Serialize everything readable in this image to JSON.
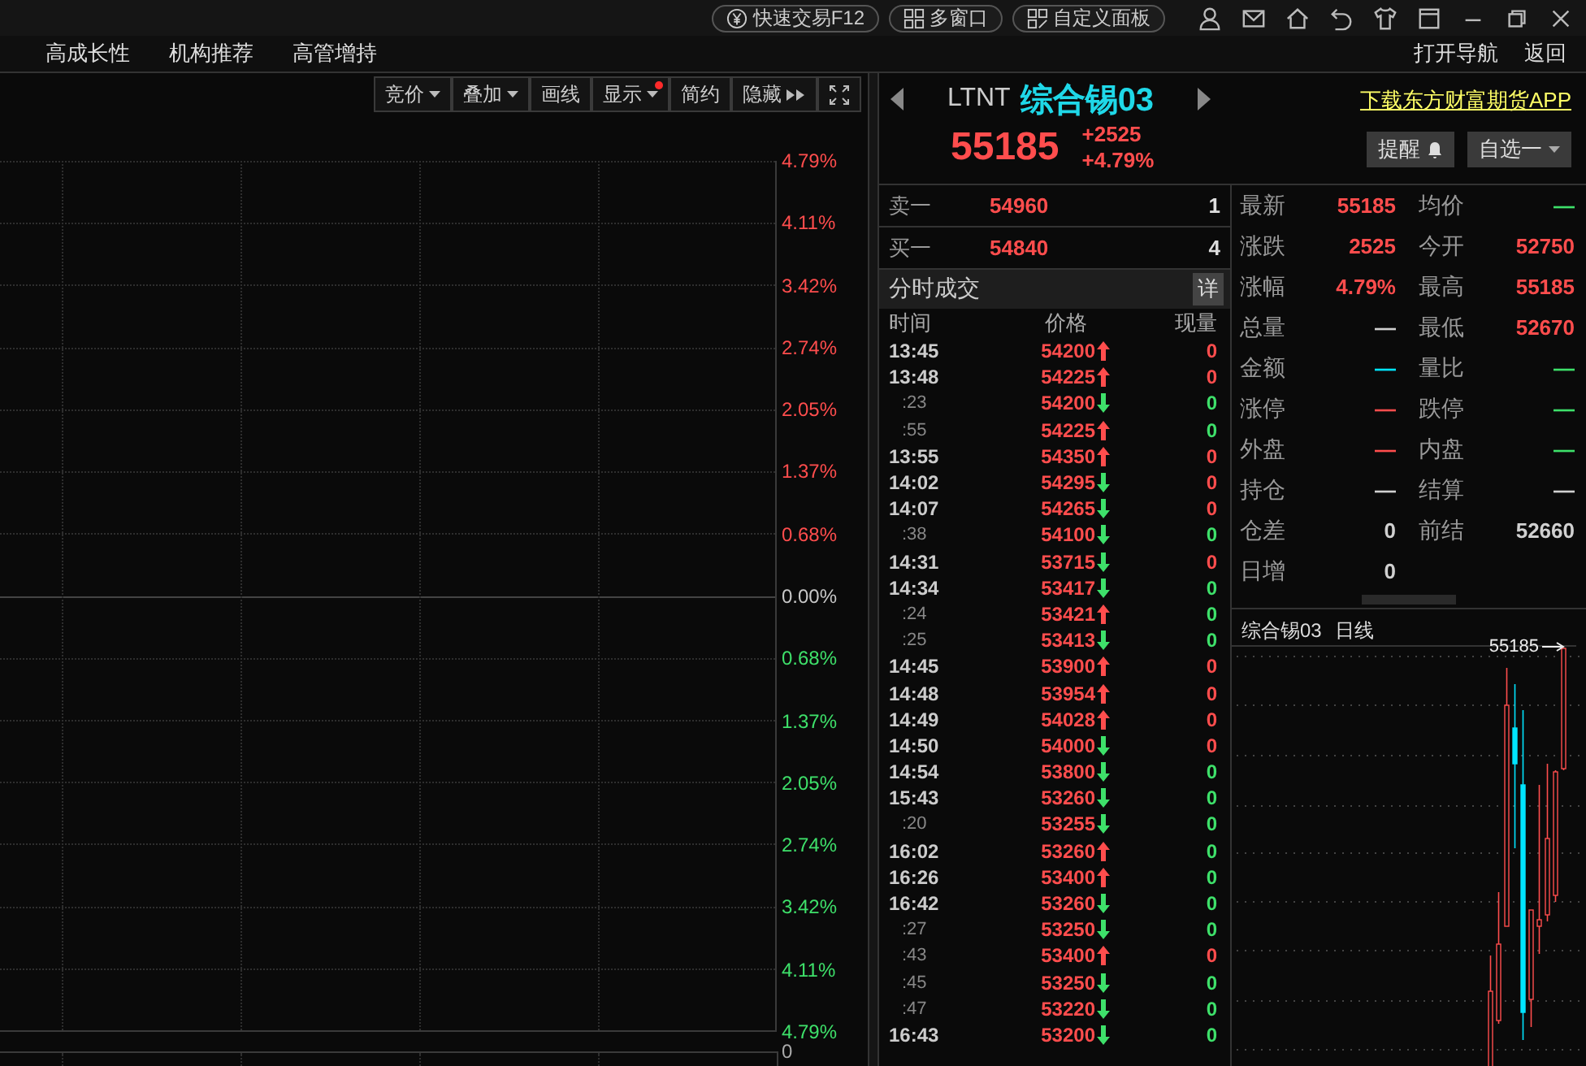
{
  "top_bar": {
    "buttons": [
      {
        "label": "快速交易F12",
        "kind": "yen"
      },
      {
        "label": "多窗口",
        "kind": "grid"
      },
      {
        "label": "自定义面板",
        "kind": "custom"
      }
    ]
  },
  "nav": {
    "items": [
      "高成长性",
      "机构推荐",
      "高管增持"
    ],
    "right_items": [
      "打开导航",
      "返回"
    ]
  },
  "chart_toolbar": [
    {
      "label": "竞价",
      "kind": "dropdown",
      "badge": false
    },
    {
      "label": "叠加",
      "kind": "dropdown",
      "badge": false
    },
    {
      "label": "画线",
      "kind": "plain",
      "badge": false
    },
    {
      "label": "显示",
      "kind": "dropdown",
      "badge": true
    },
    {
      "label": "简约",
      "kind": "plain",
      "badge": false
    },
    {
      "label": "隐藏",
      "kind": "collapse",
      "badge": false
    }
  ],
  "price_axis": [
    {
      "label": "4.79%",
      "color": "#ff4d4d"
    },
    {
      "label": "4.11%",
      "color": "#ff4d4d"
    },
    {
      "label": "3.42%",
      "color": "#ff4d4d"
    },
    {
      "label": "2.74%",
      "color": "#ff4d4d"
    },
    {
      "label": "2.05%",
      "color": "#ff4d4d"
    },
    {
      "label": "1.37%",
      "color": "#ff4d4d"
    },
    {
      "label": "0.68%",
      "color": "#ff4d4d"
    },
    {
      "label": "0.00%",
      "color": "#c8c8c8"
    },
    {
      "label": "0.68%",
      "color": "#3ee06a"
    },
    {
      "label": "1.37%",
      "color": "#3ee06a"
    },
    {
      "label": "2.05%",
      "color": "#3ee06a"
    },
    {
      "label": "2.74%",
      "color": "#3ee06a"
    },
    {
      "label": "3.42%",
      "color": "#3ee06a"
    },
    {
      "label": "4.11%",
      "color": "#3ee06a"
    },
    {
      "label": "4.79%",
      "color": "#3ee06a"
    }
  ],
  "volume_axis": {
    "label": "0"
  },
  "quote": {
    "code": "LTNT",
    "name": "综合锡03",
    "price": "55185",
    "change": "+2525",
    "change_pct": "+4.79%",
    "link": "下载东方财富期货APP",
    "alert_button": "提醒",
    "watchlist_button": "自选一"
  },
  "order_book": [
    {
      "label": "卖一",
      "price": "54960",
      "qty": "1"
    },
    {
      "label": "买一",
      "price": "54840",
      "qty": "4"
    }
  ],
  "trades": {
    "title": "分时成交",
    "detail_button": "详",
    "columns": [
      "时间",
      "价格",
      "现量"
    ],
    "rows": [
      {
        "time": "13:45",
        "kind": "minute",
        "price": "54200",
        "up": true,
        "volume": "0",
        "color": "#ff4d4d"
      },
      {
        "time": "13:48",
        "kind": "minute",
        "price": "54225",
        "up": true,
        "volume": "0",
        "color": "#ff4d4d"
      },
      {
        "time": ":23",
        "kind": "second",
        "price": "54200",
        "up": false,
        "volume": "0",
        "color": "#3ee06a"
      },
      {
        "time": ":55",
        "kind": "second",
        "price": "54225",
        "up": true,
        "volume": "0",
        "color": "#3ee06a"
      },
      {
        "time": "13:55",
        "kind": "minute",
        "price": "54350",
        "up": true,
        "volume": "0",
        "color": "#ff4d4d"
      },
      {
        "time": "14:02",
        "kind": "minute",
        "price": "54295",
        "up": false,
        "volume": "0",
        "color": "#ff4d4d"
      },
      {
        "time": "14:07",
        "kind": "minute",
        "price": "54265",
        "up": false,
        "volume": "0",
        "color": "#ff4d4d"
      },
      {
        "time": ":38",
        "kind": "second",
        "price": "54100",
        "up": false,
        "volume": "0",
        "color": "#3ee06a"
      },
      {
        "time": "14:31",
        "kind": "minute",
        "price": "53715",
        "up": false,
        "volume": "0",
        "color": "#ff4d4d"
      },
      {
        "time": "14:34",
        "kind": "minute",
        "price": "53417",
        "up": false,
        "volume": "0",
        "color": "#3ee06a"
      },
      {
        "time": ":24",
        "kind": "second",
        "price": "53421",
        "up": true,
        "volume": "0",
        "color": "#3ee06a"
      },
      {
        "time": ":25",
        "kind": "second",
        "price": "53413",
        "up": false,
        "volume": "0",
        "color": "#3ee06a"
      },
      {
        "time": "14:45",
        "kind": "minute",
        "price": "53900",
        "up": true,
        "volume": "0",
        "color": "#ff4d4d"
      },
      {
        "time": "14:48",
        "kind": "minute",
        "price": "53954",
        "up": true,
        "volume": "0",
        "color": "#ff4d4d"
      },
      {
        "time": "14:49",
        "kind": "minute",
        "price": "54028",
        "up": true,
        "volume": "0",
        "color": "#ff4d4d"
      },
      {
        "time": "14:50",
        "kind": "minute",
        "price": "54000",
        "up": false,
        "volume": "0",
        "color": "#ff4d4d"
      },
      {
        "time": "14:54",
        "kind": "minute",
        "price": "53800",
        "up": false,
        "volume": "0",
        "color": "#3ee06a"
      },
      {
        "time": "15:43",
        "kind": "minute",
        "price": "53260",
        "up": false,
        "volume": "0",
        "color": "#3ee06a"
      },
      {
        "time": ":20",
        "kind": "second",
        "price": "53255",
        "up": false,
        "volume": "0",
        "color": "#3ee06a"
      },
      {
        "time": "16:02",
        "kind": "minute",
        "price": "53260",
        "up": true,
        "volume": "0",
        "color": "#3ee06a"
      },
      {
        "time": "16:26",
        "kind": "minute",
        "price": "53400",
        "up": true,
        "volume": "0",
        "color": "#3ee06a"
      },
      {
        "time": "16:42",
        "kind": "minute",
        "price": "53260",
        "up": false,
        "volume": "0",
        "color": "#3ee06a"
      },
      {
        "time": ":27",
        "kind": "second",
        "price": "53250",
        "up": false,
        "volume": "0",
        "color": "#3ee06a"
      },
      {
        "time": ":43",
        "kind": "second",
        "price": "53400",
        "up": true,
        "volume": "0",
        "color": "#ff4d4d"
      },
      {
        "time": ":45",
        "kind": "second",
        "price": "53250",
        "up": false,
        "volume": "0",
        "color": "#3ee06a"
      },
      {
        "time": ":47",
        "kind": "second",
        "price": "53220",
        "up": false,
        "volume": "0",
        "color": "#3ee06a"
      },
      {
        "time": "16:43",
        "kind": "minute",
        "price": "53200",
        "up": false,
        "volume": "0",
        "color": "#3ee06a"
      }
    ]
  },
  "stats": [
    {
      "label": "最新",
      "value": "55185",
      "color": "#ff4d4d"
    },
    {
      "label": "均价",
      "value": "—",
      "color": "#3ee06a"
    },
    {
      "label": "涨跌",
      "value": "2525",
      "color": "#ff4d4d"
    },
    {
      "label": "今开",
      "value": "52750",
      "color": "#ff4d4d"
    },
    {
      "label": "涨幅",
      "value": "4.79%",
      "color": "#ff4d4d"
    },
    {
      "label": "最高",
      "value": "55185",
      "color": "#ff4d4d"
    },
    {
      "label": "总量",
      "value": "—",
      "color": "#d0d0d0"
    },
    {
      "label": "最低",
      "value": "52670",
      "color": "#ff4d4d"
    },
    {
      "label": "金额",
      "value": "—",
      "color": "#00e5ff"
    },
    {
      "label": "量比",
      "value": "—",
      "color": "#3ee06a"
    },
    {
      "label": "涨停",
      "value": "—",
      "color": "#ff4d4d"
    },
    {
      "label": "跌停",
      "value": "—",
      "color": "#3ee06a"
    },
    {
      "label": "外盘",
      "value": "—",
      "color": "#ff4d4d"
    },
    {
      "label": "内盘",
      "value": "—",
      "color": "#3ee06a"
    },
    {
      "label": "持仓",
      "value": "—",
      "color": "#d0d0d0"
    },
    {
      "label": "结算",
      "value": "—",
      "color": "#d0d0d0"
    },
    {
      "label": "仓差",
      "value": "0",
      "color": "#d0d0d0"
    },
    {
      "label": "前结",
      "value": "52660",
      "color": "#d0d0d0"
    },
    {
      "label": "日增",
      "value": "0",
      "color": "#d0d0d0"
    }
  ],
  "daily_chart": {
    "name": "综合锡03",
    "period": "日线",
    "marker": "55185"
  }
}
